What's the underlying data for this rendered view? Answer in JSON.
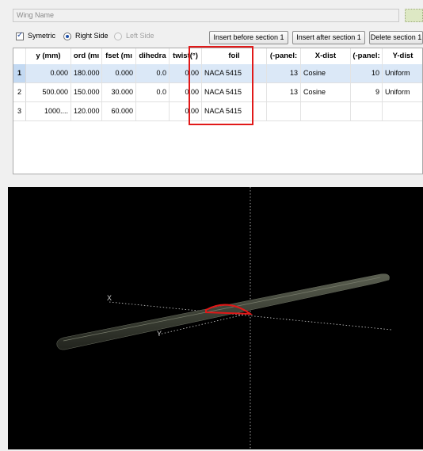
{
  "wing_name": {
    "placeholder": "Wing Name"
  },
  "options": {
    "symmetric": "Symetric",
    "right_side": "Right Side",
    "left_side": "Left Side"
  },
  "buttons": {
    "insert_before": "Insert before section 1",
    "insert_after": "Insert after section 1",
    "delete": "Delete section 1"
  },
  "table": {
    "headers": [
      "y (mm)",
      "ord (mı",
      "fset (mı",
      "dihedra",
      "twist(°)",
      "foil",
      "(-panel:",
      "X-dist",
      "(-panel:",
      "Y-dist"
    ],
    "rows": [
      {
        "num": "1",
        "y": "0.000",
        "chord": "180.000",
        "offset": "0.000",
        "dihedral": "0.0",
        "twist": "0.00",
        "foil": "NACA 5415",
        "xpanels": "13",
        "xdist": "Cosine",
        "ypanels": "10",
        "ydist": "Uniform"
      },
      {
        "num": "2",
        "y": "500.000",
        "chord": "150.000",
        "offset": "30.000",
        "dihedral": "0.0",
        "twist": "0.00",
        "foil": "NACA 5415",
        "xpanels": "13",
        "xdist": "Cosine",
        "ypanels": "9",
        "ydist": "Uniform"
      },
      {
        "num": "3",
        "y": "1000....",
        "chord": "120.000",
        "offset": "60.000",
        "dihedral": "",
        "twist": "0.00",
        "foil": "NACA 5415",
        "xpanels": "",
        "xdist": "",
        "ypanels": "",
        "ydist": ""
      }
    ]
  },
  "viewer": {
    "axis_x_label": "X",
    "axis_y_label": "Y"
  },
  "colors": {
    "highlight": "#e11919",
    "wing": "#3a3d34",
    "selection": "#c3d9f2"
  }
}
